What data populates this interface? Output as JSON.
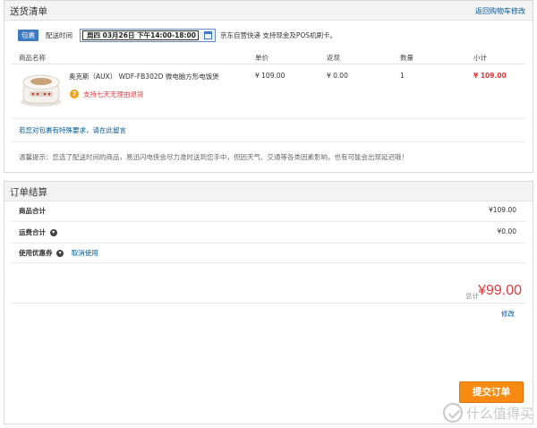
{
  "shipping": {
    "title": "送货清单",
    "back_link": "返回购物车修改",
    "package_badge": "包裹",
    "time_label": "配送时间",
    "time_value": "周四 03月26日 下午14:00-18:00",
    "note": "京东自营快递 支持现金及POS机刷卡。",
    "columns": [
      "商品名称",
      "单价",
      "返现",
      "数量",
      "小计"
    ],
    "product": {
      "name": "奥克斯（AUX） WDF-FB302D 微电脑方形电饭煲",
      "return_badge": "7",
      "return_text": "支持七天无理由退货",
      "price": "¥ 109.00",
      "cashback": "¥ 0.00",
      "qty": "1",
      "subtotal": "¥ 109.00"
    },
    "remark_link": "若您对包裹有特殊要求，请在此留言",
    "hint": "温馨提示：您选了配送时间的商品，易迅闪电侠会尽力准时送到您手中，但因天气、交通等各类因素影响，也有可能会出现延迟哦！"
  },
  "order": {
    "title": "订单结算",
    "rows": [
      {
        "label": "商品合计",
        "value": "¥109.00"
      },
      {
        "label": "运费合计",
        "value": "¥0.00"
      },
      {
        "label": "使用优惠券",
        "value": ""
      }
    ],
    "cancel_link": "取消使用",
    "total_label": "总计",
    "total_amount": "¥99.00",
    "edit_link": "修改",
    "submit": "提交订单"
  },
  "watermark": "什么值得买",
  "colors": {
    "accent": "#f68a12",
    "price_red": "#e4393c",
    "link": "#005aa0",
    "badge": "#3f7ac1"
  }
}
